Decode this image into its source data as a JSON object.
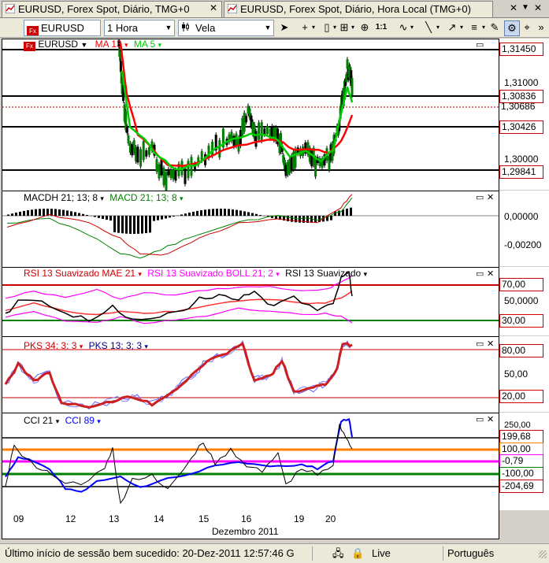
{
  "tabs": [
    {
      "label": "EURUSD, Forex Spot, Diário, TMG+0"
    },
    {
      "label": "EURUSD, Forex Spot, Diário, Hora Local (TMG+0)"
    }
  ],
  "toolbar": {
    "symbol": "EURUSD",
    "interval": "1 Hora",
    "chart_type": "Vela",
    "zoom_label": "1:1"
  },
  "main_pane": {
    "symbol_label": "EURUSD",
    "ma_label": "MA 13",
    "ma5_label": "MA 5",
    "price_labels": [
      "1,31000",
      "1,30000"
    ],
    "price_boxes": [
      "1,31450",
      "1,30836",
      "1,30686",
      "1,30426",
      "1,29841"
    ]
  },
  "macd_pane": {
    "legend1": "MACDH 21; 13; 8",
    "legend2": "MACD 21; 13; 8",
    "labels": [
      "0,00000",
      "-0,00200"
    ]
  },
  "rsi_pane": {
    "legend1": "RSI 13 Suavizado MAE 21",
    "legend2": "RSI 13 Suavizado BOLL 21; 2",
    "legend3": "RSI 13 Suavizado",
    "boxes": [
      "70,00",
      "30,00"
    ],
    "labels": [
      "50,0000"
    ]
  },
  "pks_pane": {
    "legend1": "PKS 34; 3; 3",
    "legend2": "PKS 13; 3; 3",
    "boxes": [
      "80,00",
      "20,00"
    ],
    "labels": [
      "50,00"
    ]
  },
  "cci_pane": {
    "legend1": "CCI 21",
    "legend2": "CCI 89",
    "boxes": [
      "199,68",
      "100,00",
      "-0,79",
      "-100,00",
      "-204,69"
    ],
    "labels": [
      "250,00"
    ]
  },
  "xaxis": {
    "ticks": [
      "09",
      "12",
      "13",
      "14",
      "15",
      "16",
      "19",
      "20"
    ],
    "month_label": "Dezembro 2011"
  },
  "status": {
    "session_text": "Último início de sessão bem sucedido: 20-Dez-2011 12:57:46 G",
    "connection": "Live",
    "language": "Português"
  },
  "colors": {
    "candle": "#008000",
    "ma13": "#ff0000",
    "ma5": "#00cc00",
    "level_line": "#000000",
    "rsi_band": "#ff00ff",
    "overbought_line": "#cc0000",
    "oversold_line": "#008000",
    "cci89": "#0000ff",
    "cci100": "#ff8000",
    "cci0": "#ff00ff"
  }
}
